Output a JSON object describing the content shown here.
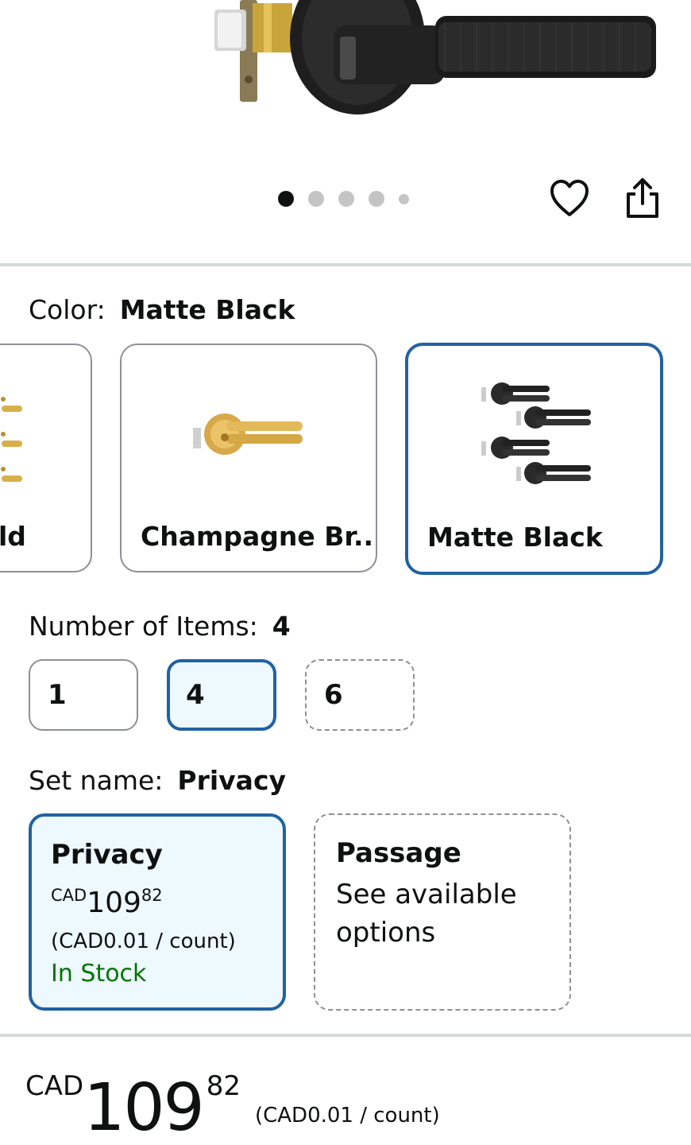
{
  "carousel": {
    "image_count": 5,
    "active_index": 0
  },
  "icons": {
    "favorite": "heart-outline-icon",
    "share": "share-icon"
  },
  "color": {
    "label": "Color:",
    "selected": "Matte Black",
    "options": [
      {
        "name": "ld",
        "swatch_colors": [
          "#d8b04a"
        ]
      },
      {
        "name": "Champagne Br...",
        "swatch_colors": [
          "#e0b85a"
        ]
      },
      {
        "name": "Matte Black",
        "swatch_colors": [
          "#2a2a2a"
        ]
      }
    ]
  },
  "items": {
    "label": "Number of Items:",
    "selected": "4",
    "options": [
      "1",
      "4",
      "6"
    ]
  },
  "set_name": {
    "label": "Set name:",
    "selected": "Privacy",
    "options": [
      {
        "title": "Privacy",
        "currency": "CAD",
        "price_whole": "109",
        "price_cents": "82",
        "unit_price": "(CAD0.01 / count)",
        "stock": "In Stock"
      },
      {
        "title": "Passage",
        "note": "See available options"
      }
    ]
  },
  "price": {
    "currency": "CAD",
    "whole": "109",
    "cents": "82",
    "unit_price": "(CAD0.01 / count)"
  },
  "colors": {
    "accent": "#2162a1",
    "selected_bg": "#edf8ff",
    "in_stock": "#007600",
    "border": "#8d9096"
  }
}
